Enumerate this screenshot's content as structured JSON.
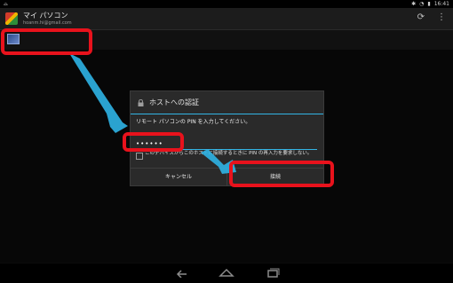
{
  "status_bar": {
    "time": "16:41"
  },
  "app_bar": {
    "title": "マイ パソコン",
    "account": "hoanm.hi@gmail.com"
  },
  "dialog": {
    "title": "ホストへの認証",
    "message": "リモート パソコンの PIN を入力してください。",
    "pin_value": "••••••",
    "remember_label": "このデバイスからこのホストに接続するときに PIN の再入力を要求しない。",
    "cancel_label": "キャンセル",
    "connect_label": "接続"
  },
  "colors": {
    "accent": "#33b5e5",
    "callout": "#e8121c",
    "arrow": "#2fb4e6"
  },
  "icons": [
    "refresh-icon",
    "overflow-menu-icon",
    "lock-icon",
    "back-icon",
    "home-icon",
    "recents-icon"
  ]
}
